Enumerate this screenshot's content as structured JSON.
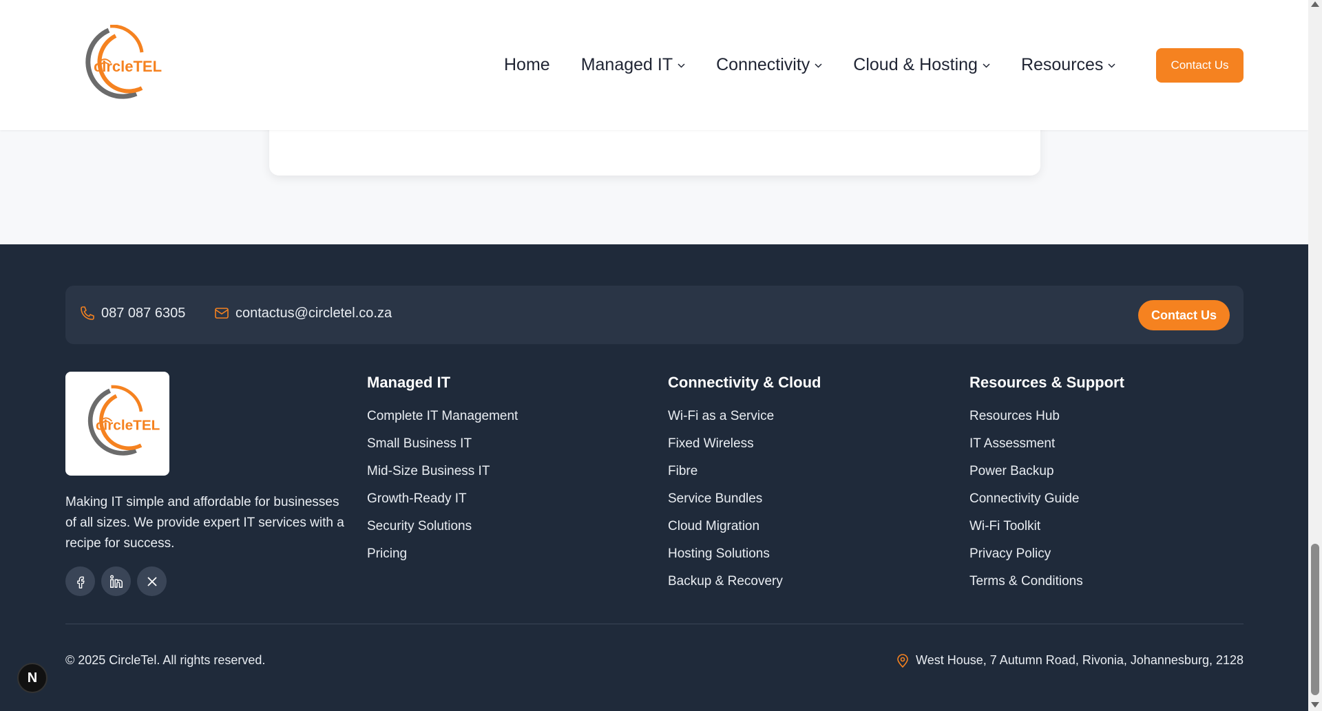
{
  "header": {
    "logo_text": "circleTEL",
    "nav": [
      {
        "label": "Home",
        "dropdown": false
      },
      {
        "label": "Managed IT",
        "dropdown": true
      },
      {
        "label": "Connectivity",
        "dropdown": true
      },
      {
        "label": "Cloud & Hosting",
        "dropdown": true
      },
      {
        "label": "Resources",
        "dropdown": true
      }
    ],
    "contact_button": "Contact Us"
  },
  "footer": {
    "phone": "087 087 6305",
    "email": "contactus@circletel.co.za",
    "contact_button": "Contact Us",
    "logo_text": "circleTEL",
    "about": "Making IT simple and affordable for businesses of all sizes. We provide expert IT services with a recipe for success.",
    "socials": [
      "facebook-icon",
      "linkedin-icon",
      "x-icon"
    ],
    "columns": [
      {
        "title": "Managed IT",
        "links": [
          "Complete IT Management",
          "Small Business IT",
          "Mid-Size Business IT",
          "Growth-Ready IT",
          "Security Solutions",
          "Pricing"
        ]
      },
      {
        "title": "Connectivity & Cloud",
        "links": [
          "Wi-Fi as a Service",
          "Fixed Wireless",
          "Fibre",
          "Service Bundles",
          "Cloud Migration",
          "Hosting Solutions",
          "Backup & Recovery"
        ]
      },
      {
        "title": "Resources & Support",
        "links": [
          "Resources Hub",
          "IT Assessment",
          "Power Backup",
          "Connectivity Guide",
          "Wi-Fi Toolkit",
          "Privacy Policy",
          "Terms & Conditions"
        ]
      }
    ],
    "copyright": "© 2025 CircleTel. All rights reserved.",
    "address": "West House, 7 Autumn Road, Rivonia, Johannesburg, 2128"
  },
  "dev_badge": "N",
  "colors": {
    "accent": "#f58220",
    "footer_bg": "#1f2a3a",
    "bar_bg": "#2a3546"
  }
}
